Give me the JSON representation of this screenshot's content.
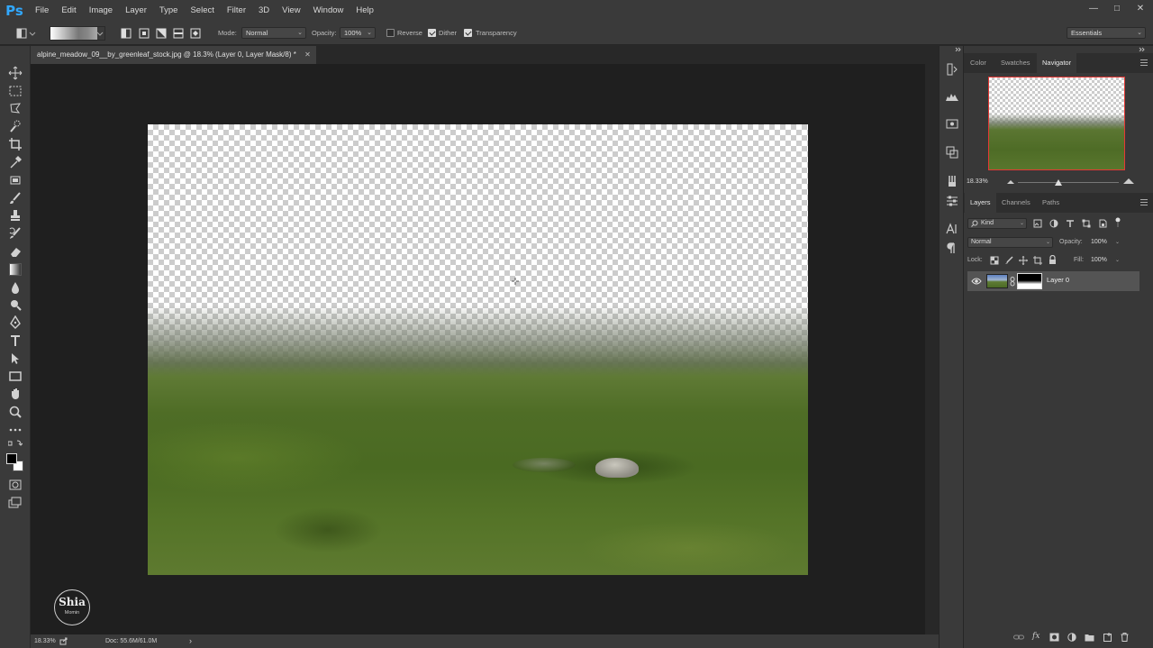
{
  "app": {
    "logo": "Ps"
  },
  "menu": [
    "File",
    "Edit",
    "Image",
    "Layer",
    "Type",
    "Select",
    "Filter",
    "3D",
    "View",
    "Window",
    "Help"
  ],
  "window_controls": [
    "—",
    "□",
    "✕"
  ],
  "options": {
    "mode_label": "Mode:",
    "mode_value": "Normal",
    "opacity_label": "Opacity:",
    "opacity_value": "100%",
    "reverse_label": "Reverse",
    "reverse_checked": false,
    "dither_label": "Dither",
    "dither_checked": true,
    "transparency_label": "Transparency",
    "transparency_checked": true,
    "workspace": "Essentials"
  },
  "document": {
    "tab_title": "alpine_meadow_09__by_greenleaf_stock.jpg @ 18.3% (Layer 0, Layer Mask/8) *",
    "close": "✕"
  },
  "status": {
    "zoom": "18.33%",
    "doc_info": "Doc: 55.6M/61.0M",
    "arrow": "›"
  },
  "watermark": {
    "name": "Shia",
    "sub": "Momin"
  },
  "top_panel": {
    "tabs": [
      "Color",
      "Swatches",
      "Navigator"
    ],
    "active_tab": "Navigator",
    "zoom": "18.33%"
  },
  "layers_panel": {
    "tabs": [
      "Layers",
      "Channels",
      "Paths"
    ],
    "active_tab": "Layers",
    "filter_kind": "Kind",
    "blend_mode": "Normal",
    "opacity_label": "Opacity:",
    "opacity_value": "100%",
    "lock_label": "Lock:",
    "fill_label": "Fill:",
    "fill_value": "100%",
    "layers": [
      {
        "name": "Layer 0",
        "visible": true,
        "has_mask": true
      }
    ]
  },
  "colors": {
    "accent": "#31a8ff",
    "navigator_box": "#e53935",
    "foreground": "#000000",
    "background": "#ffffff"
  }
}
